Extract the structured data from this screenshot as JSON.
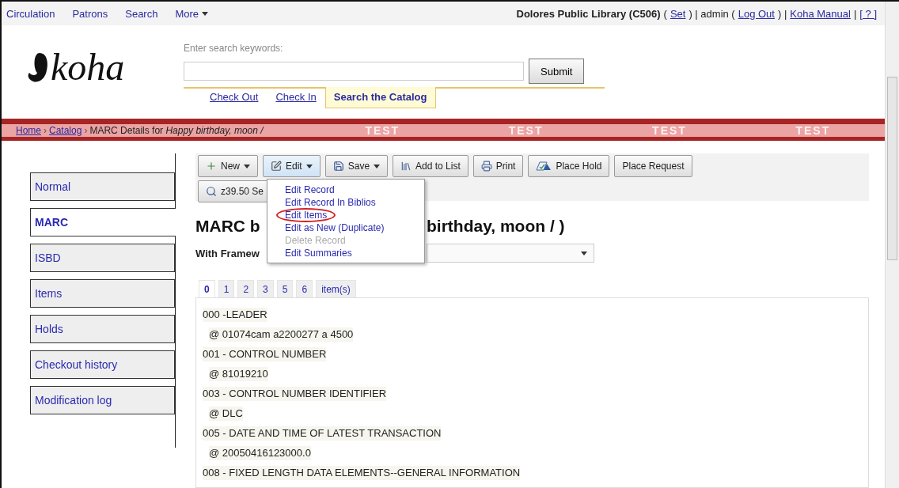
{
  "top_nav": {
    "links": [
      {
        "label": "Circulation",
        "dropdown": false
      },
      {
        "label": "Patrons",
        "dropdown": false
      },
      {
        "label": "Search",
        "dropdown": false
      },
      {
        "label": "More",
        "dropdown": true
      }
    ],
    "user_bar": [
      {
        "kind": "bold",
        "text": "Dolores Public Library (C506)"
      },
      {
        "kind": "text",
        "text": "("
      },
      {
        "kind": "link",
        "text": "Set"
      },
      {
        "kind": "text",
        "text": ") | admin ("
      },
      {
        "kind": "link",
        "text": "Log Out"
      },
      {
        "kind": "text",
        "text": ") |"
      },
      {
        "kind": "link",
        "text": "Koha Manual"
      },
      {
        "kind": "text",
        "text": "|"
      },
      {
        "kind": "link",
        "text": "[ ? ]"
      }
    ]
  },
  "logo": {
    "text": "koha"
  },
  "search": {
    "label": "Enter search keywords:",
    "button": "Submit",
    "tabs": [
      {
        "label": "Check Out",
        "selected": false
      },
      {
        "label": "Check In",
        "selected": false
      },
      {
        "label": "Search the Catalog",
        "selected": true
      }
    ]
  },
  "breadcrumb": {
    "parts": [
      {
        "kind": "link",
        "text": "Home"
      },
      {
        "kind": "sep",
        "text": "›"
      },
      {
        "kind": "link",
        "text": "Catalog"
      },
      {
        "kind": "sep",
        "text": "›"
      },
      {
        "kind": "text",
        "text": "MARC Details for *Happy birthday, moon /*"
      }
    ],
    "banner_labels": [
      "TEST",
      "TEST",
      "TEST",
      "TEST"
    ]
  },
  "sidebar": {
    "items": [
      {
        "label": "Normal",
        "selected": false
      },
      {
        "label": "MARC",
        "selected": true
      },
      {
        "label": "ISBD",
        "selected": false
      },
      {
        "label": "Items",
        "selected": false
      },
      {
        "label": "Holds",
        "selected": false
      },
      {
        "label": "Checkout history",
        "selected": false
      },
      {
        "label": "Modification log",
        "selected": false
      }
    ]
  },
  "toolbar": {
    "buttons": [
      {
        "label": "New",
        "kind": "new",
        "dropdown": true,
        "active": false
      },
      {
        "label": "Edit",
        "kind": "edit",
        "dropdown": true,
        "active": true
      },
      {
        "label": "Save",
        "kind": "save",
        "dropdown": true,
        "active": false
      },
      {
        "label": "Add to List",
        "kind": "list",
        "dropdown": false,
        "active": false
      },
      {
        "label": "Print",
        "kind": "print",
        "dropdown": false,
        "active": false
      },
      {
        "label": "Place Hold",
        "kind": "hold",
        "dropdown": false,
        "active": false
      },
      {
        "label": "Place Request",
        "kind": "plain",
        "dropdown": false,
        "active": false
      }
    ],
    "second_row": [
      {
        "label": "z39.50 Se",
        "kind": "search",
        "active": false
      }
    ]
  },
  "edit_menu": {
    "items": [
      {
        "label": "Edit Record",
        "disabled": false,
        "circled": false
      },
      {
        "label": "Edit Record In Biblios",
        "disabled": false,
        "circled": false
      },
      {
        "label": "Edit Items",
        "disabled": false,
        "circled": true
      },
      {
        "label": "Edit as New (Duplicate)",
        "disabled": false,
        "circled": false
      },
      {
        "label": "Delete Record",
        "disabled": true,
        "circled": false
      },
      {
        "label": "Edit Summaries",
        "disabled": false,
        "circled": false
      }
    ]
  },
  "heading_parts": [
    "MARC b",
    "birthday, moon / )"
  ],
  "framework": {
    "label": "With Framew"
  },
  "marc_tabs": [
    {
      "label": "0",
      "selected": true
    },
    {
      "label": "1",
      "selected": false
    },
    {
      "label": "2",
      "selected": false
    },
    {
      "label": "3",
      "selected": false
    },
    {
      "label": "5",
      "selected": false
    },
    {
      "label": "6",
      "selected": false
    },
    {
      "label": "item(s)",
      "selected": false
    }
  ],
  "fields": [
    {
      "kind": "tag",
      "text": "000 -LEADER"
    },
    {
      "kind": "subfield",
      "text": "@ 01074cam a2200277 a 4500"
    },
    {
      "kind": "tag",
      "text": "001 - CONTROL NUMBER"
    },
    {
      "kind": "subfield",
      "text": "@ 81019210"
    },
    {
      "kind": "tag",
      "text": "003 - CONTROL NUMBER IDENTIFIER"
    },
    {
      "kind": "subfield",
      "text": "@ DLC"
    },
    {
      "kind": "tag",
      "text": "005 - DATE AND TIME OF LATEST TRANSACTION"
    },
    {
      "kind": "subfield",
      "text": "@ 20050416123000.0"
    },
    {
      "kind": "tag",
      "text": "008 - FIXED LENGTH DATA ELEMENTS--GENERAL INFORMATION"
    }
  ]
}
